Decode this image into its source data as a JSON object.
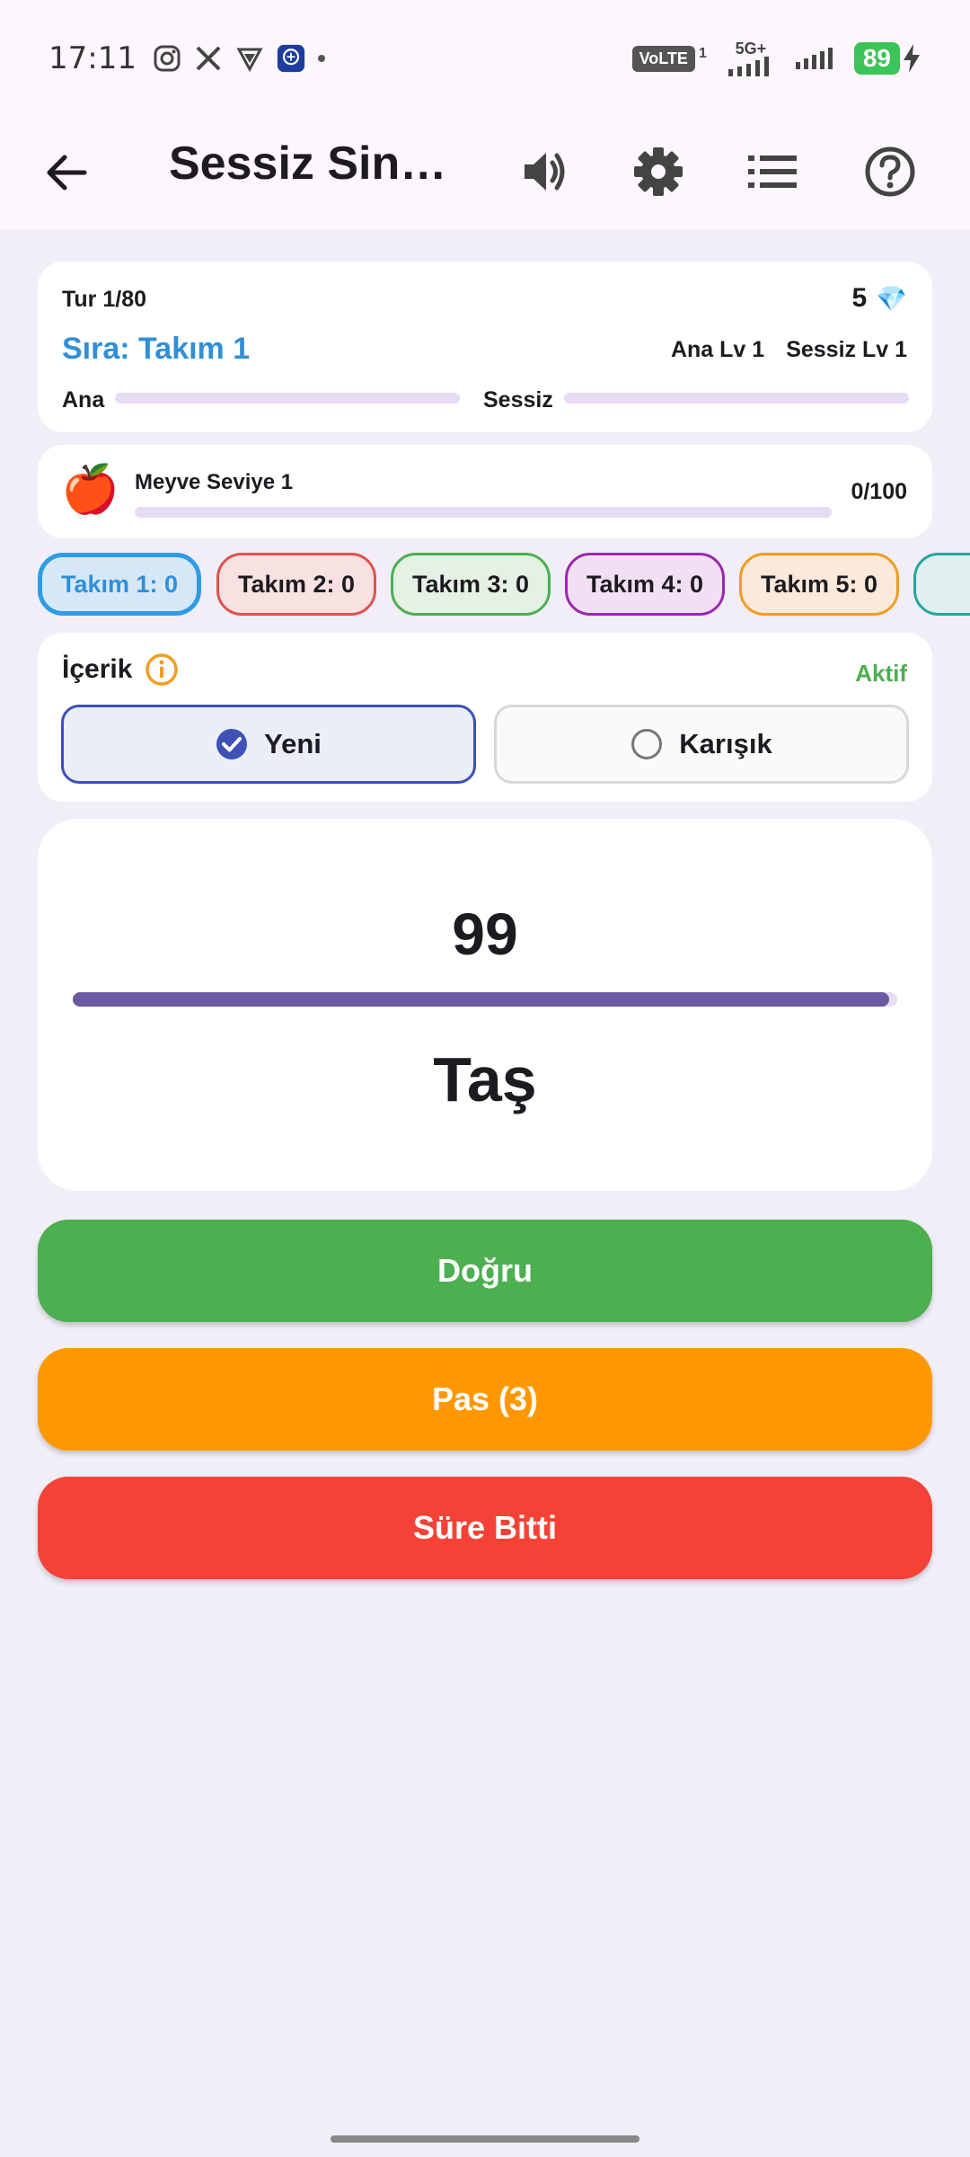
{
  "status_bar": {
    "time": "17:11",
    "volte": "VoLTE",
    "sim_index": "1",
    "network": "5G+",
    "battery": "89"
  },
  "app_bar": {
    "title": "Sessiz Sin…",
    "icons": [
      "back-arrow-icon",
      "volume-icon",
      "gear-icon",
      "list-icon",
      "help-icon"
    ]
  },
  "round_card": {
    "round": "Tur 1/80",
    "gems": "5",
    "gem_icon": "💎",
    "turn": "Sıra: Takım 1",
    "ana_level": "Ana Lv 1",
    "sessiz_level": "Sessiz Lv 1",
    "ana_label": "Ana",
    "sessiz_label": "Sessiz",
    "ana_progress": 0,
    "sessiz_progress": 0
  },
  "category_card": {
    "icon": "🍎",
    "label": "Meyve Seviye 1",
    "progress_text": "0/100",
    "progress": 0
  },
  "teams": [
    {
      "label": "Takım 1: 0",
      "border": "#2f9be3",
      "bg": "#d6e8f7",
      "text": "#2f8fd8",
      "active": true
    },
    {
      "label": "Takım 2: 0",
      "border": "#e0524c",
      "bg": "#f7e1e1",
      "text": "#1d1b20"
    },
    {
      "label": "Takım 3: 0",
      "border": "#4caf50",
      "bg": "#e4f1e4",
      "text": "#1d1b20"
    },
    {
      "label": "Takım 4: 0",
      "border": "#9c27b0",
      "bg": "#f1e0f3",
      "text": "#1d1b20"
    },
    {
      "label": "Takım 5: 0",
      "border": "#f39c1f",
      "bg": "#fbeadb",
      "text": "#1d1b20"
    }
  ],
  "content_card": {
    "label": "İçerik",
    "status": "Aktif",
    "options": [
      {
        "label": "Yeni",
        "selected": true
      },
      {
        "label": "Karışık",
        "selected": false
      }
    ]
  },
  "timer_card": {
    "seconds": "99",
    "timer_fill": 0.99,
    "word": "Taş"
  },
  "buttons": {
    "correct": "Doğru",
    "pass": "Pas (3)",
    "time_up": "Süre Bitti"
  },
  "colors": {
    "accent_blue": "#2f8fd8",
    "green": "#4caf50",
    "orange": "#ff9800",
    "red": "#f44336",
    "purple": "#6a5a9f"
  }
}
